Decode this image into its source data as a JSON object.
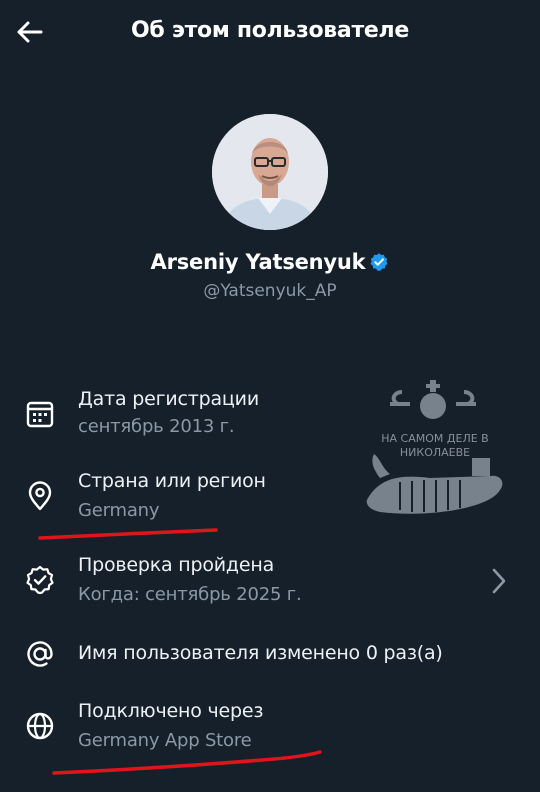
{
  "header": {
    "title": "Об этом пользователе"
  },
  "profile": {
    "name": "Arseniy Yatsenyuk",
    "handle": "@Yatsenyuk_AP",
    "verified": true
  },
  "rows": [
    {
      "icon": "calendar-icon",
      "label": "Дата регистрации",
      "value": "сентябрь 2013 г."
    },
    {
      "icon": "location-pin-icon",
      "label": "Страна или регион",
      "value": "Germany"
    },
    {
      "icon": "verified-badge-outline-icon",
      "label": "Проверка пройдена",
      "value": "Когда: сентябрь 2025 г."
    },
    {
      "icon": "at-sign-icon",
      "label": "Имя пользователя изменено 0 раз(а)"
    },
    {
      "icon": "globe-icon",
      "label": "Подключено через",
      "value": "Germany App Store"
    }
  ],
  "watermark": {
    "line1": "НА САМОМ ДЕЛЕ В",
    "line2": "НИКОЛАЕВЕ"
  },
  "colors": {
    "background": "#16202b",
    "text_primary": "#ffffff",
    "text_secondary": "#8b98a5",
    "verified_blue": "#1d9bf0",
    "annotation_red": "#e0151b"
  }
}
